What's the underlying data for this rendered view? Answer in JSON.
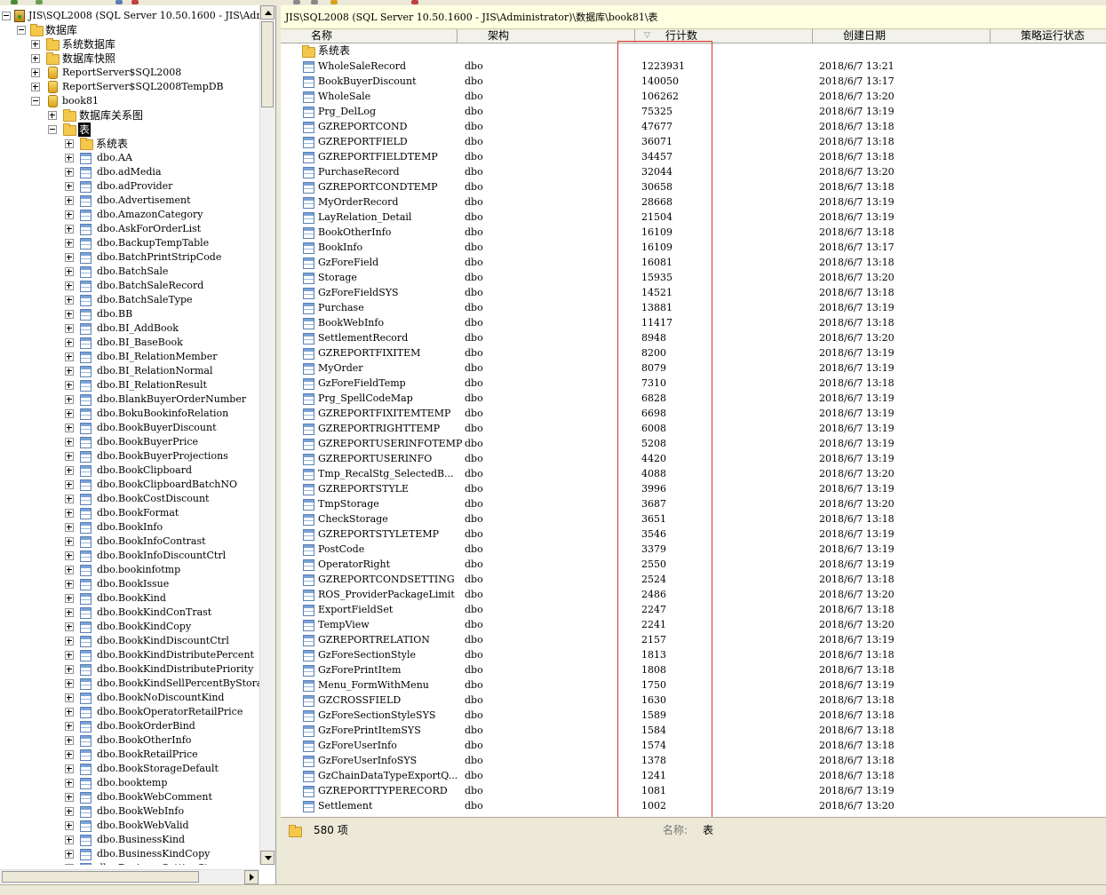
{
  "tree": {
    "server": "JIS\\SQL2008 (SQL Server 10.50.1600 - JIS\\Adm",
    "databases": "数据库",
    "system_databases": "系统数据库",
    "snapshots": "数据库快照",
    "db1": "ReportServer$SQL2008",
    "db2": "ReportServer$SQL2008TempDB",
    "db3": "book81",
    "diagrams": "数据库关系图",
    "tables": "表",
    "system_tables": "系统表",
    "table_items": [
      "dbo.AA",
      "dbo.adMedia",
      "dbo.adProvider",
      "dbo.Advertisement",
      "dbo.AmazonCategory",
      "dbo.AskForOrderList",
      "dbo.BackupTempTable",
      "dbo.BatchPrintStripCode",
      "dbo.BatchSale",
      "dbo.BatchSaleRecord",
      "dbo.BatchSaleType",
      "dbo.BB",
      "dbo.BI_AddBook",
      "dbo.BI_BaseBook",
      "dbo.BI_RelationMember",
      "dbo.BI_RelationNormal",
      "dbo.BI_RelationResult",
      "dbo.BlankBuyerOrderNumber",
      "dbo.BokuBookinfoRelation",
      "dbo.BookBuyerDiscount",
      "dbo.BookBuyerPrice",
      "dbo.BookBuyerProjections",
      "dbo.BookClipboard",
      "dbo.BookClipboardBatchNO",
      "dbo.BookCostDiscount",
      "dbo.BookFormat",
      "dbo.BookInfo",
      "dbo.BookInfoContrast",
      "dbo.BookInfoDiscountCtrl",
      "dbo.bookinfotmp",
      "dbo.BookIssue",
      "dbo.BookKind",
      "dbo.BookKindConTrast",
      "dbo.BookKindCopy",
      "dbo.BookKindDiscountCtrl",
      "dbo.BookKindDistributePercent",
      "dbo.BookKindDistributePriority",
      "dbo.BookKindSellPercentByStorag",
      "dbo.BookNoDiscountKind",
      "dbo.BookOperatorRetailPrice",
      "dbo.BookOrderBind",
      "dbo.BookOtherInfo",
      "dbo.BookRetailPrice",
      "dbo.BookStorageDefault",
      "dbo.booktemp",
      "dbo.BookWebComment",
      "dbo.BookWebInfo",
      "dbo.BookWebValid",
      "dbo.BusinessKind",
      "dbo.BusinessKindCopy",
      "dbo.BusinessSettingStep"
    ]
  },
  "right": {
    "path": "JIS\\SQL2008 (SQL Server 10.50.1600 - JIS\\Administrator)\\数据库\\book81\\表",
    "columns": {
      "name": "名称",
      "schema": "架构",
      "rowcount": "行计数",
      "created": "创建日期",
      "policy": "策略运行状态"
    },
    "system_tables": "系统表",
    "rows": [
      [
        "WholeSaleRecord",
        "dbo",
        "1223931",
        "2018/6/7 13:21"
      ],
      [
        "BookBuyerDiscount",
        "dbo",
        "140050",
        "2018/6/7 13:17"
      ],
      [
        "WholeSale",
        "dbo",
        "106262",
        "2018/6/7 13:20"
      ],
      [
        "Prg_DelLog",
        "dbo",
        "75325",
        "2018/6/7 13:19"
      ],
      [
        "GZREPORTCOND",
        "dbo",
        "47677",
        "2018/6/7 13:18"
      ],
      [
        "GZREPORTFIELD",
        "dbo",
        "36071",
        "2018/6/7 13:18"
      ],
      [
        "GZREPORTFIELDTEMP",
        "dbo",
        "34457",
        "2018/6/7 13:18"
      ],
      [
        "PurchaseRecord",
        "dbo",
        "32044",
        "2018/6/7 13:20"
      ],
      [
        "GZREPORTCONDTEMP",
        "dbo",
        "30658",
        "2018/6/7 13:18"
      ],
      [
        "MyOrderRecord",
        "dbo",
        "28668",
        "2018/6/7 13:19"
      ],
      [
        "LayRelation_Detail",
        "dbo",
        "21504",
        "2018/6/7 13:19"
      ],
      [
        "BookOtherInfo",
        "dbo",
        "16109",
        "2018/6/7 13:18"
      ],
      [
        "BookInfo",
        "dbo",
        "16109",
        "2018/6/7 13:17"
      ],
      [
        "GzForeField",
        "dbo",
        "16081",
        "2018/6/7 13:18"
      ],
      [
        "Storage",
        "dbo",
        "15935",
        "2018/6/7 13:20"
      ],
      [
        "GzForeFieldSYS",
        "dbo",
        "14521",
        "2018/6/7 13:18"
      ],
      [
        "Purchase",
        "dbo",
        "13881",
        "2018/6/7 13:19"
      ],
      [
        "BookWebInfo",
        "dbo",
        "11417",
        "2018/6/7 13:18"
      ],
      [
        "SettlementRecord",
        "dbo",
        "8948",
        "2018/6/7 13:20"
      ],
      [
        "GZREPORTFIXITEM",
        "dbo",
        "8200",
        "2018/6/7 13:19"
      ],
      [
        "MyOrder",
        "dbo",
        "8079",
        "2018/6/7 13:19"
      ],
      [
        "GzForeFieldTemp",
        "dbo",
        "7310",
        "2018/6/7 13:18"
      ],
      [
        "Prg_SpellCodeMap",
        "dbo",
        "6828",
        "2018/6/7 13:19"
      ],
      [
        "GZREPORTFIXITEMTEMP",
        "dbo",
        "6698",
        "2018/6/7 13:19"
      ],
      [
        "GZREPORTRIGHTTEMP",
        "dbo",
        "6008",
        "2018/6/7 13:19"
      ],
      [
        "GZREPORTUSERINFOTEMP",
        "dbo",
        "5208",
        "2018/6/7 13:19"
      ],
      [
        "GZREPORTUSERINFO",
        "dbo",
        "4420",
        "2018/6/7 13:19"
      ],
      [
        "Tmp_RecalStg_SelectedB...",
        "dbo",
        "4088",
        "2018/6/7 13:20"
      ],
      [
        "GZREPORTSTYLE",
        "dbo",
        "3996",
        "2018/6/7 13:19"
      ],
      [
        "TmpStorage",
        "dbo",
        "3687",
        "2018/6/7 13:20"
      ],
      [
        "CheckStorage",
        "dbo",
        "3651",
        "2018/6/7 13:18"
      ],
      [
        "GZREPORTSTYLETEMP",
        "dbo",
        "3546",
        "2018/6/7 13:19"
      ],
      [
        "PostCode",
        "dbo",
        "3379",
        "2018/6/7 13:19"
      ],
      [
        "OperatorRight",
        "dbo",
        "2550",
        "2018/6/7 13:19"
      ],
      [
        "GZREPORTCONDSETTING",
        "dbo",
        "2524",
        "2018/6/7 13:18"
      ],
      [
        "ROS_ProviderPackageLimit",
        "dbo",
        "2486",
        "2018/6/7 13:20"
      ],
      [
        "ExportFieldSet",
        "dbo",
        "2247",
        "2018/6/7 13:18"
      ],
      [
        "TempView",
        "dbo",
        "2241",
        "2018/6/7 13:20"
      ],
      [
        "GZREPORTRELATION",
        "dbo",
        "2157",
        "2018/6/7 13:19"
      ],
      [
        "GzForeSectionStyle",
        "dbo",
        "1813",
        "2018/6/7 13:18"
      ],
      [
        "GzForePrintItem",
        "dbo",
        "1808",
        "2018/6/7 13:18"
      ],
      [
        "Menu_FormWithMenu",
        "dbo",
        "1750",
        "2018/6/7 13:19"
      ],
      [
        "GZCROSSFIELD",
        "dbo",
        "1630",
        "2018/6/7 13:18"
      ],
      [
        "GzForeSectionStyleSYS",
        "dbo",
        "1589",
        "2018/6/7 13:18"
      ],
      [
        "GzForePrintItemSYS",
        "dbo",
        "1584",
        "2018/6/7 13:18"
      ],
      [
        "GzForeUserInfo",
        "dbo",
        "1574",
        "2018/6/7 13:18"
      ],
      [
        "GzForeUserInfoSYS",
        "dbo",
        "1378",
        "2018/6/7 13:18"
      ],
      [
        "GzChainDataTypeExportQ...",
        "dbo",
        "1241",
        "2018/6/7 13:18"
      ],
      [
        "GZREPORTTYPERECORD",
        "dbo",
        "1081",
        "2018/6/7 13:19"
      ],
      [
        "Settlement",
        "dbo",
        "1002",
        "2018/6/7 13:20"
      ]
    ],
    "status": {
      "count": "580 项",
      "name_label": "名称:",
      "name_value": "表"
    }
  },
  "colors": {
    "highlight_box": "#e03030",
    "path_bar": "#ffffe1",
    "chrome": "#ece9d8"
  }
}
